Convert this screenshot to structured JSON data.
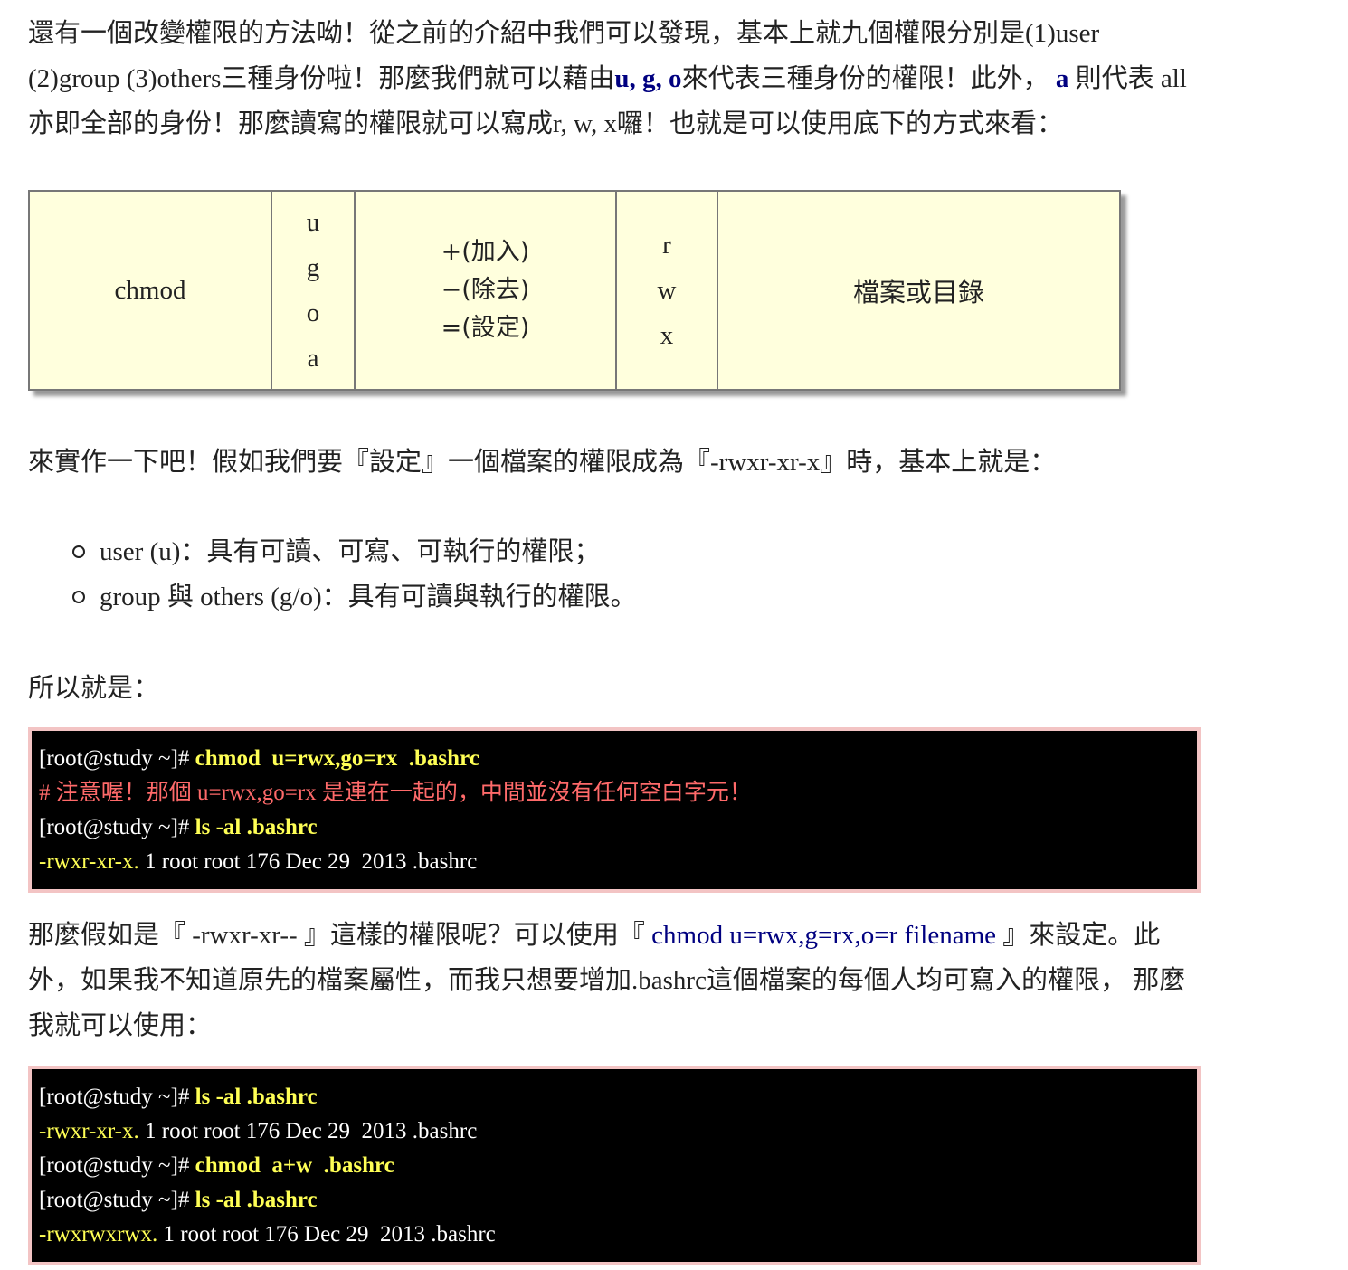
{
  "intro": {
    "line1": "還有一個改變權限的方法呦！從之前的介紹中我們可以發現，基本上就九個權限分別是(1)user",
    "line2_a": "(2)group (3)others三種身份啦！那麼我們就可以藉由",
    "line2_ugo": "u, g, o",
    "line2_b": "來代表三種身份的權限！此外，",
    "line2_a_letter": "a",
    "line2_c": "則代表 all",
    "line3": "亦即全部的身份！那麼讀寫的權限就可以寫成r, w, x囉！也就是可以使用底下的方式來看："
  },
  "syntax_table": {
    "command": "chmod",
    "who": [
      "u",
      "g",
      "o",
      "a"
    ],
    "ops": [
      "+(加入)",
      "−(除去)",
      "=(設定)"
    ],
    "perms": [
      "r",
      "w",
      "x"
    ],
    "target": "檔案或目錄"
  },
  "example_intro": "來實作一下吧！假如我們要『設定』一個檔案的權限成為『-rwxr-xr-x』時，基本上就是：",
  "bullets": [
    "user (u)：具有可讀、可寫、可執行的權限；",
    "group 與 others (g/o)：具有可讀與執行的權限。"
  ],
  "so_label": "所以就是：",
  "terminal1": {
    "l1_prompt": "[root@study ~]# ",
    "l1_cmd": "chmod  u=rwx,go=rx  .bashrc",
    "l2_comment": "# 注意喔！那個 u=rwx,go=rx 是連在一起的，中間並沒有任何空白字元！",
    "l3_prompt": "[root@study ~]# ",
    "l3_cmd": "ls -al .bashrc",
    "l4_perm": "-rwxr-xr-x.",
    "l4_rest": " 1 root root 176 Dec 29  2013 .bashrc"
  },
  "second_para": {
    "line1_a": "那麼假如是『 -rwxr-xr-- 』這樣的權限呢？可以使用『 ",
    "line1_cmd": "chmod u=rwx,g=rx,o=r filename",
    "line1_b": " 』來設定。此",
    "line2": "外，如果我不知道原先的檔案屬性，而我只想要增加.bashrc這個檔案的每個人均可寫入的權限， 那麼",
    "line3": "我就可以使用："
  },
  "terminal2": {
    "l1_prompt": "[root@study ~]# ",
    "l1_cmd": "ls -al .bashrc",
    "l2_perm": "-rwxr-xr-x.",
    "l2_rest": " 1 root root 176 Dec 29  2013 .bashrc",
    "l3_prompt": "[root@study ~]# ",
    "l3_cmd": "chmod  a+w  .bashrc",
    "l4_prompt": "[root@study ~]# ",
    "l4_cmd": "ls -al .bashrc",
    "l5_perm": "-rwxrwxrwx.",
    "l5_rest": " 1 root root 176 Dec 29  2013 .bashrc"
  }
}
